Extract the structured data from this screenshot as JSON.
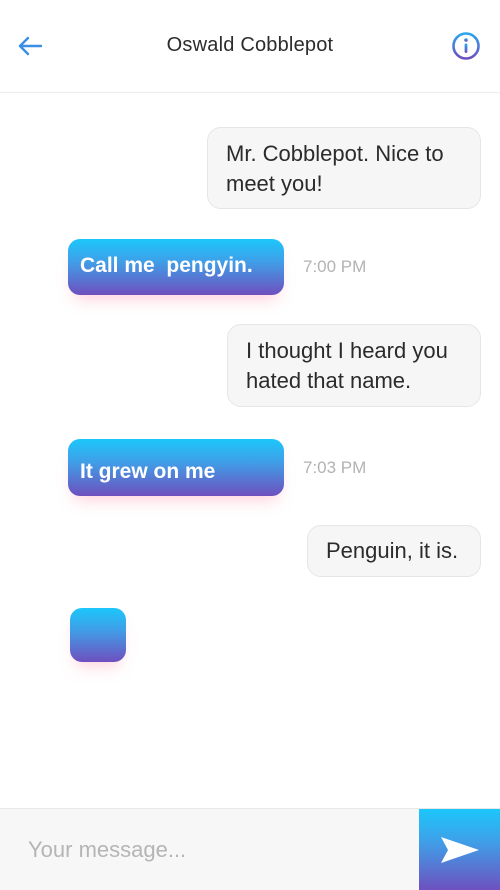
{
  "header": {
    "title": "Oswald Cobblepot",
    "back_icon": "arrow-left-icon",
    "info_icon": "info-circle-icon"
  },
  "colors": {
    "accent_top": "#1cc7fb",
    "accent_bottom": "#6e4fbe",
    "incoming_bg": "#f6f6f6",
    "timestamp": "#b3b3b3"
  },
  "messages": [
    {
      "direction": "incoming",
      "text_lines": [
        "Mr. Cobblepot. Nice to",
        "meet you!"
      ]
    },
    {
      "direction": "outgoing",
      "text": "Call me  pengyin.",
      "time": "7:00 PM"
    },
    {
      "direction": "incoming",
      "text_lines": [
        "I thought I heard you",
        "hated that name."
      ]
    },
    {
      "direction": "outgoing",
      "text": "It grew on me",
      "time": "7:03 PM"
    },
    {
      "direction": "incoming",
      "text": "Penguin, it is."
    },
    {
      "direction": "outgoing",
      "text": ""
    }
  ],
  "composer": {
    "placeholder": "Your message...",
    "value": "",
    "send_icon": "paper-plane-send-icon"
  }
}
